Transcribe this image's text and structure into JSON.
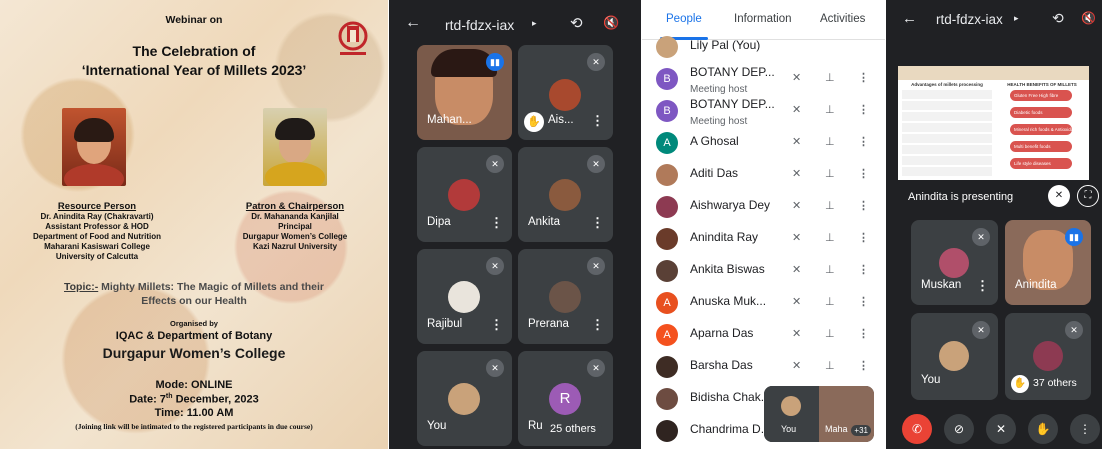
{
  "poster": {
    "webinar_on": "Webinar on",
    "title1": "The Celebration of",
    "title2": "‘International Year of Millets 2023’",
    "resource_heading": "Resource Person",
    "resource_lines": [
      "Dr. Anindita Ray (Chakravarti)",
      "Assistant Professor & HOD",
      "Department of Food and Nutrition",
      "Maharani Kasiswari College",
      "University of Calcutta"
    ],
    "patron_heading": "Patron & Chairperson",
    "patron_lines": [
      "Dr. Mahananda Kanjilal",
      "Principal",
      "Durgapur Women’s College",
      "Kazi Nazrul University"
    ],
    "topic_label": "Topic:-",
    "topic_text1": " Mighty Millets: The Magic of Millets and their",
    "topic_text2": "Effects on our Health",
    "organised_by": "Organised by",
    "organiser1": "IQAC & Department of Botany",
    "organiser2": "Durgapur Women’s College",
    "mode": "Mode: ONLINE",
    "date_prefix": "Date: 7",
    "date_sup": "th",
    "date_suffix": " December, 2023",
    "time": "Time: 11.00 AM",
    "note": "(Joining link will be intimated to the registered participants in due course)"
  },
  "meet": {
    "meeting_code": "rtd-fdzx-iax",
    "tiles": [
      {
        "name": "Mahan..."
      },
      {
        "name": "Ais..."
      },
      {
        "name": "Dipa"
      },
      {
        "name": "Ankita"
      },
      {
        "name": "Rajibul"
      },
      {
        "name": "Prerana"
      },
      {
        "name": "You"
      },
      {
        "name": "Ru",
        "initial": "R"
      }
    ],
    "others": "25 others"
  },
  "people": {
    "tabs": [
      "People",
      "Information",
      "Activities"
    ],
    "rows": [
      {
        "name": "Lily Pal (You)",
        "sub": "",
        "initial": "",
        "color": "#c9a27a"
      },
      {
        "name": "BOTANY DEP...",
        "sub": "Meeting host",
        "initial": "B",
        "color": "#7e57c2"
      },
      {
        "name": "BOTANY DEP...",
        "sub": "Meeting host",
        "initial": "B",
        "color": "#7e57c2"
      },
      {
        "name": "A Ghosal",
        "sub": "",
        "initial": "A",
        "color": "#00897b"
      },
      {
        "name": "Aditi Das",
        "sub": "",
        "initial": "",
        "color": "#b07a5a"
      },
      {
        "name": "Aishwarya Dey",
        "sub": "",
        "initial": "",
        "color": "#8d3a52"
      },
      {
        "name": "Anindita Ray",
        "sub": "",
        "initial": "",
        "color": "#6a3b2a"
      },
      {
        "name": "Ankita Biswas",
        "sub": "",
        "initial": "",
        "color": "#5a4036"
      },
      {
        "name": "Anuska Muk...",
        "sub": "",
        "initial": "A",
        "color": "#e8501f"
      },
      {
        "name": "Aparna Das",
        "sub": "",
        "initial": "A",
        "color": "#f4511e"
      },
      {
        "name": "Barsha Das",
        "sub": "",
        "initial": "",
        "color": "#3e2c24"
      },
      {
        "name": "Bidisha Chak...",
        "sub": "",
        "initial": "",
        "color": "#6d4c41"
      },
      {
        "name": "Chandrima D...",
        "sub": "",
        "initial": "",
        "color": "#2f2420"
      }
    ],
    "pip_you": "You",
    "pip_name": "Maha",
    "pip_count": "+31"
  },
  "present": {
    "meeting_code": "rtd-fdzx-iax",
    "slide_left_title": "Advantages of millets processing",
    "slide_right_title": "HEALTH BENEFITS OF MILLETS",
    "slide_benefits": [
      "Gluten Free High fibre",
      "Diabetic foods",
      "Mineral rich foods & Antioxidants",
      "Multi benefit foods",
      "Life style diseases"
    ],
    "presenting_label": "Anindita is presenting",
    "tiles": [
      {
        "name": "Muskan"
      },
      {
        "name": "Anindita"
      },
      {
        "name": "You"
      },
      {
        "name": ""
      }
    ],
    "others": "37 others"
  }
}
